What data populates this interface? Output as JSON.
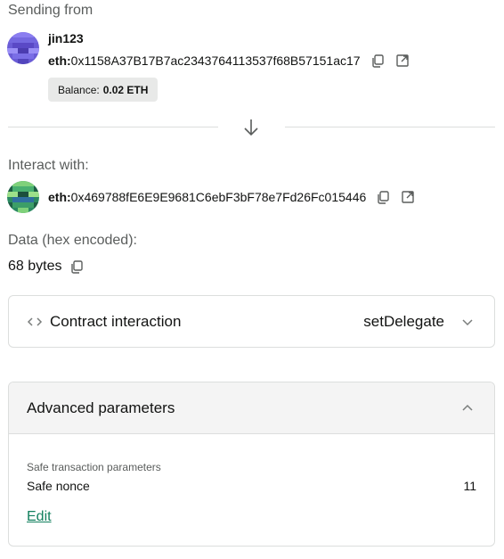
{
  "sending": {
    "label": "Sending from",
    "owner_name": "jin123",
    "address_prefix": "eth:",
    "address": "0x1158A37B17B7ac2343764113537f68B57151ac17",
    "balance_label": "Balance:",
    "balance_value": "0.02 ETH"
  },
  "interact": {
    "label": "Interact with:",
    "address_prefix": "eth:",
    "address": "0x469788fE6E9E9681C6ebF3bF78e7Fd26Fc015446"
  },
  "data": {
    "label": "Data (hex encoded):",
    "size": "68 bytes"
  },
  "contract": {
    "title": "Contract interaction",
    "method": "setDelegate"
  },
  "advanced": {
    "title": "Advanced parameters",
    "safe_params_label": "Safe transaction parameters",
    "nonce_label": "Safe nonce",
    "nonce_value": "11",
    "edit_label": "Edit"
  },
  "icons": {
    "copy": "copy-icon",
    "external": "external-link-icon",
    "arrow": "arrow-down-icon",
    "code": "code-icon",
    "chevron_down": "chevron-down-icon",
    "chevron_up": "chevron-up-icon"
  },
  "colors": {
    "link": "#12805e",
    "border": "#dcdedd",
    "muted_text": "#5a5d5c"
  }
}
